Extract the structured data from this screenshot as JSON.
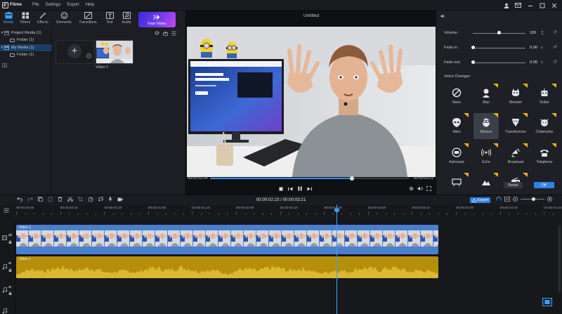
{
  "app": {
    "name": "Filme",
    "menu": [
      "File",
      "Settings",
      "Export",
      "Help"
    ]
  },
  "toolbar": {
    "tabs": [
      {
        "label": "Media",
        "icon": "media-icon",
        "active": true
      },
      {
        "label": "Filters",
        "icon": "filters-icon",
        "active": false
      },
      {
        "label": "Effects",
        "icon": "effects-icon",
        "active": false
      },
      {
        "label": "Elements",
        "icon": "elements-icon",
        "active": false
      },
      {
        "label": "Transitions",
        "icon": "transitions-icon",
        "active": false
      },
      {
        "label": "Text",
        "icon": "text-icon",
        "active": false
      },
      {
        "label": "Audio",
        "icon": "audio-icon",
        "active": false
      }
    ],
    "fast_video": "Fast Video"
  },
  "media": {
    "tree": [
      {
        "label": "Project Media (1)",
        "level": 0,
        "selected": false
      },
      {
        "label": "Folder (1)",
        "level": 1,
        "selected": false
      },
      {
        "label": "My Media (1)",
        "level": 0,
        "selected": true
      },
      {
        "label": "Folder (1)",
        "level": 1,
        "selected": false
      }
    ],
    "clip_label": "Video 1"
  },
  "preview": {
    "title": "Untitled",
    "current_time": "00:00:02:24",
    "duration": "00:00:03:21",
    "progress": 0.71
  },
  "audio_panel": {
    "volume_label": "Volume:",
    "volume_value": "100",
    "volume_level": 0.5,
    "fade_in_label": "Fade in:",
    "fade_in_value": "0.00",
    "fade_out_label": "Fade out:",
    "fade_out_value": "0.00",
    "unit": "s",
    "voice_changer_label": "Voice Changer:",
    "voices": [
      {
        "label": "None",
        "icon": "none-icon",
        "selected": false,
        "premium": false
      },
      {
        "label": "Man",
        "icon": "man-icon",
        "selected": false,
        "premium": true
      },
      {
        "label": "Monster",
        "icon": "monster-icon",
        "selected": false,
        "premium": true
      },
      {
        "label": "Robot",
        "icon": "robot-icon",
        "selected": false,
        "premium": true
      },
      {
        "label": "Alien",
        "icon": "alien-icon",
        "selected": false,
        "premium": true
      },
      {
        "label": "Minions",
        "icon": "minions-icon",
        "selected": true,
        "premium": true
      },
      {
        "label": "Transformers",
        "icon": "transformers-icon",
        "selected": false,
        "premium": true
      },
      {
        "label": "Chipmunks",
        "icon": "chipmunks-icon",
        "selected": false,
        "premium": true
      },
      {
        "label": "Astronaut",
        "icon": "astronaut-icon",
        "selected": false,
        "premium": true
      },
      {
        "label": "Echo",
        "icon": "echo-icon",
        "selected": false,
        "premium": true
      },
      {
        "label": "Broadcast",
        "icon": "broadcast-icon",
        "selected": false,
        "premium": true
      },
      {
        "label": "Telephone",
        "icon": "telephone-icon",
        "selected": false,
        "premium": true
      },
      {
        "label": "",
        "icon": "stage-icon",
        "selected": false,
        "premium": true
      },
      {
        "label": "",
        "icon": "mountain-icon",
        "selected": false,
        "premium": true
      },
      {
        "label": "",
        "icon": "radio-icon",
        "selected": false,
        "premium": true
      }
    ],
    "reset_label": "Reset",
    "ok_label": "OK"
  },
  "timeline": {
    "time_display": "00:00:02:23 / 00:00:03:21",
    "export_label": "Export",
    "ruler": [
      "00:00:00:00",
      "00:00:00:10",
      "00:00:00:20",
      "00:00:01:05",
      "00:00:01:15",
      "00:00:02:00",
      "00:00:02:10",
      "00:00:02:20",
      "00:00:03:05",
      "00:00:03:15",
      "00:00:04:00",
      "00:00:04:10",
      "00:00:04:20"
    ],
    "video_clip_label": "Video 1",
    "audio_clip_label": "Video 1"
  },
  "colors": {
    "accent": "#2f83e6",
    "video_clip": "#4a7fcf",
    "audio_clip": "#b58f0b",
    "fast_video_start": "#3a2cd6",
    "fast_video_end": "#c44bf2"
  }
}
